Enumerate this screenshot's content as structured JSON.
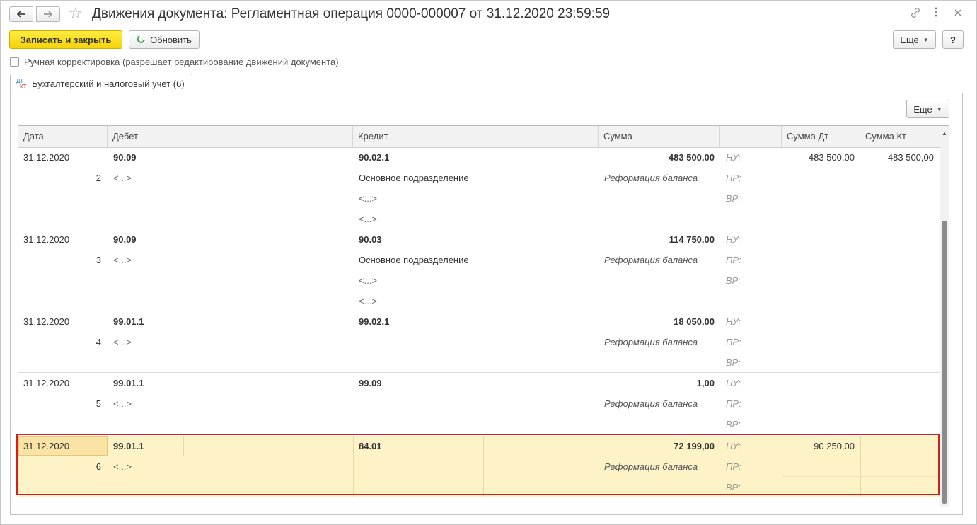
{
  "window": {
    "title": "Движения документа: Регламентная операция 0000-000007 от 31.12.2020 23:59:59"
  },
  "toolbar": {
    "save_close": "Записать и закрыть",
    "refresh": "Обновить",
    "more": "Еще",
    "help": "?"
  },
  "manual_edit": {
    "label": "Ручная корректировка (разрешает редактирование движений документа)",
    "checked": false
  },
  "tab": {
    "label": "Бухгалтерский и налоговый учет (6)"
  },
  "table": {
    "more": "Еще",
    "headers": {
      "date": "Дата",
      "debit": "Дебет",
      "credit": "Кредит",
      "sum": "Сумма",
      "type": "",
      "sum_dt": "Сумма Дт",
      "sum_kt": "Сумма Кт"
    },
    "rows": [
      {
        "date": "31.12.2020",
        "num": "2",
        "debit": "90.09",
        "debit_sub": "<...>",
        "credit": "90.02.1",
        "credit_sub": [
          "Основное подразделение",
          "<...>",
          "<...>"
        ],
        "sum": "483 500,00",
        "content": "Реформация баланса",
        "nu": "НУ:",
        "pr": "ПР:",
        "vr": "ВР:",
        "sum_dt": "483 500,00",
        "sum_kt": "483 500,00"
      },
      {
        "date": "31.12.2020",
        "num": "3",
        "debit": "90.09",
        "debit_sub": "<...>",
        "credit": "90.03",
        "credit_sub": [
          "Основное подразделение",
          "<...>",
          "<...>"
        ],
        "sum": "114 750,00",
        "content": "Реформация баланса",
        "nu": "НУ:",
        "pr": "ПР:",
        "vr": "ВР:",
        "sum_dt": "",
        "sum_kt": ""
      },
      {
        "date": "31.12.2020",
        "num": "4",
        "debit": "99.01.1",
        "debit_sub": "<...>",
        "credit": "99.02.1",
        "credit_sub": [],
        "sum": "18 050,00",
        "content": "Реформация баланса",
        "nu": "НУ:",
        "pr": "ПР:",
        "vr": "ВР:",
        "sum_dt": "",
        "sum_kt": ""
      },
      {
        "date": "31.12.2020",
        "num": "5",
        "debit": "99.01.1",
        "debit_sub": "<...>",
        "credit": "99.09",
        "credit_sub": [],
        "sum": "1,00",
        "content": "Реформация баланса",
        "nu": "НУ:",
        "pr": "ПР:",
        "vr": "ВР:",
        "sum_dt": "",
        "sum_kt": ""
      },
      {
        "date": "31.12.2020",
        "num": "6",
        "debit": "99.01.1",
        "debit_sub": "<...>",
        "credit": "84.01",
        "credit_sub": [],
        "sum": "72 199,00",
        "content": "Реформация баланса",
        "nu": "НУ:",
        "pr": "ПР:",
        "vr": "ВР:",
        "sum_dt": "90 250,00",
        "sum_kt": ""
      }
    ]
  },
  "colors": {
    "accent_yellow": "#f6d20a",
    "selection": "#fdf3c6",
    "highlight_border": "#d91d1d"
  }
}
